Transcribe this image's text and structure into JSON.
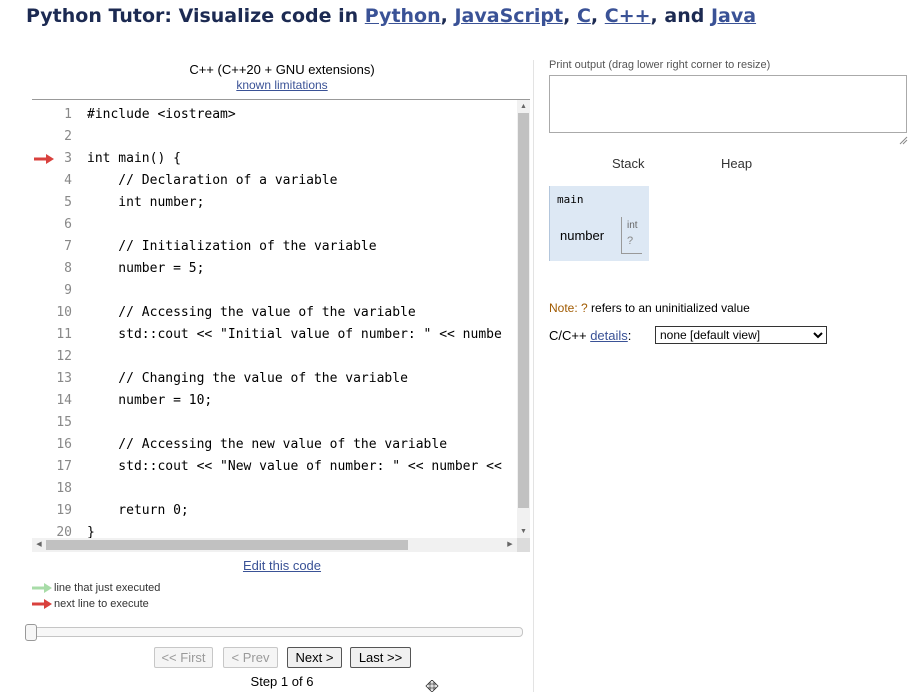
{
  "header": {
    "title_prefix": "Python Tutor: Visualize code in ",
    "languages": [
      "Python",
      "JavaScript",
      "C",
      "C++",
      "Java"
    ],
    "sep_comma": ", ",
    "sep_and": ", and "
  },
  "editor": {
    "language": "C++ (C++20 + GNU extensions)",
    "limitations_link": "known limitations",
    "current_line": 3,
    "lines": [
      {
        "n": "1",
        "text": "#include <iostream>"
      },
      {
        "n": "2",
        "text": ""
      },
      {
        "n": "3",
        "text": "int main() {"
      },
      {
        "n": "4",
        "text": "    // Declaration of a variable"
      },
      {
        "n": "5",
        "text": "    int number;"
      },
      {
        "n": "6",
        "text": ""
      },
      {
        "n": "7",
        "text": "    // Initialization of the variable"
      },
      {
        "n": "8",
        "text": "    number = 5;"
      },
      {
        "n": "9",
        "text": ""
      },
      {
        "n": "10",
        "text": "    // Accessing the value of the variable"
      },
      {
        "n": "11",
        "text": "    std::cout << \"Initial value of number: \" << numbe"
      },
      {
        "n": "12",
        "text": ""
      },
      {
        "n": "13",
        "text": "    // Changing the value of the variable"
      },
      {
        "n": "14",
        "text": "    number = 10;"
      },
      {
        "n": "15",
        "text": ""
      },
      {
        "n": "16",
        "text": "    // Accessing the new value of the variable"
      },
      {
        "n": "17",
        "text": "    std::cout << \"New value of number: \" << number <<"
      },
      {
        "n": "18",
        "text": ""
      },
      {
        "n": "19",
        "text": "    return 0;"
      },
      {
        "n": "20",
        "text": "}"
      }
    ],
    "edit_link": "Edit this code"
  },
  "legend": {
    "executed": "line that just executed",
    "next": "next line to execute"
  },
  "controls": {
    "first": "<< First",
    "prev": "< Prev",
    "next": "Next >",
    "last": "Last >>",
    "step_text": "Step 1 of 6"
  },
  "output": {
    "label": "Print output (drag lower right corner to resize)",
    "value": ""
  },
  "viz": {
    "stack_heading": "Stack",
    "heap_heading": "Heap",
    "frame_name": "main",
    "variable": {
      "name": "number",
      "type": "int",
      "value": "?"
    },
    "note_prefix": "Note: ",
    "note_q": "?",
    "note_suffix": " refers to an uninitialized value",
    "details_prefix": "C/C++ ",
    "details_link": "details",
    "details_colon": ":",
    "details_selected": "none [default view]"
  },
  "colors": {
    "title": "#1c2a52",
    "link": "#3a5296",
    "next_arrow": "#d9413d",
    "executed_arrow": "#a8dca8",
    "frame_bg": "#dde8f4"
  }
}
